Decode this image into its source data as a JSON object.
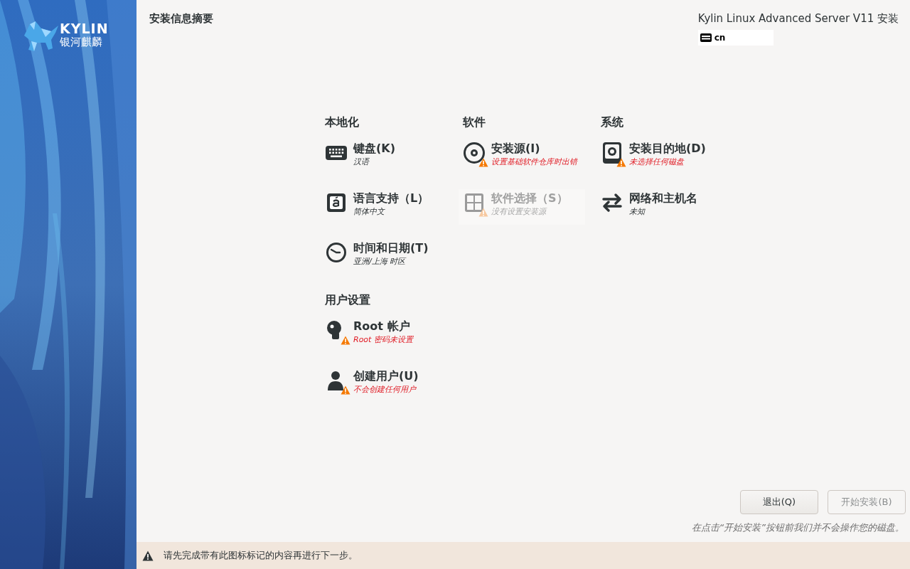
{
  "sidebar": {
    "logo": {
      "name": "KYLIN",
      "subtitle": "银河麒麟"
    }
  },
  "header": {
    "title": "安装信息摘要",
    "product": "Kylin Linux Advanced Server V11 安装",
    "keyboard_layout": "cn"
  },
  "sections": [
    {
      "title": "本地化",
      "items": [
        {
          "kind": "keyboard",
          "title": "键盘(K)",
          "status": "汉语",
          "warning": false,
          "disabled": false
        },
        {
          "kind": "language",
          "title": "语言支持（L）",
          "status": "简体中文",
          "warning": false,
          "disabled": false
        },
        {
          "kind": "clock",
          "title": "时间和日期(T)",
          "status": "亚洲/上海 时区",
          "warning": false,
          "disabled": false
        }
      ]
    },
    {
      "title": "软件",
      "items": [
        {
          "kind": "disc",
          "title": "安装源(I)",
          "status": "设置基础软件仓库时出错",
          "warning": true,
          "disabled": false
        },
        {
          "kind": "package",
          "title": "软件选择（S）",
          "status": "没有设置安装源",
          "warning": true,
          "disabled": true
        }
      ]
    },
    {
      "title": "系统",
      "items": [
        {
          "kind": "disk",
          "title": "安装目的地(D)",
          "status": "未选择任何磁盘",
          "warning": true,
          "disabled": false
        },
        {
          "kind": "network",
          "title": "网络和主机名",
          "status": "未知",
          "warning": false,
          "disabled": false
        }
      ]
    },
    {
      "title": "用户设置",
      "items": [
        {
          "kind": "key",
          "title": "Root 帐户",
          "status": "Root 密码未设置",
          "warning": true,
          "disabled": false
        },
        {
          "kind": "user",
          "title": "创建用户(U)",
          "status": "不会创建任何用户",
          "warning": true,
          "disabled": false
        }
      ]
    }
  ],
  "buttons": [
    {
      "label": "退出(Q)",
      "disabled": false
    },
    {
      "label": "开始安装(B)",
      "disabled": true
    }
  ],
  "note": "在点击“开始安装”按钮前我们并不会操作您的磁盘。",
  "warning_bar": {
    "text": "请先完成带有此图标标记的内容再进行下一步。"
  }
}
